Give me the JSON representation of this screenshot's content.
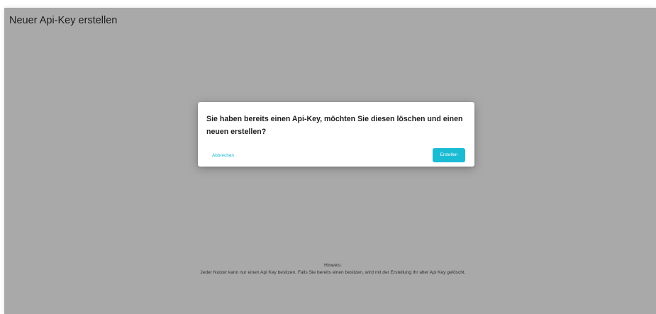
{
  "page": {
    "title": "Neuer Api-Key erstellen"
  },
  "dialog": {
    "message": "Sie haben bereits einen Api-Key, möchten Sie diesen löschen und einen neuen erstellen?",
    "cancel_label": "Abbrechen",
    "confirm_label": "Erstellen"
  },
  "hint": {
    "heading": "Hinweis:",
    "text": "Jeder Nutzer kann nur einen Api Key besitzen. Falls Sie bereits einen besitzen, wird mit der Erstellung Ihr alter Api Key gelöscht."
  },
  "colors": {
    "backdrop": "#a9a9a9",
    "accent": "#1abbd3",
    "dialog_background": "#ffffff"
  }
}
